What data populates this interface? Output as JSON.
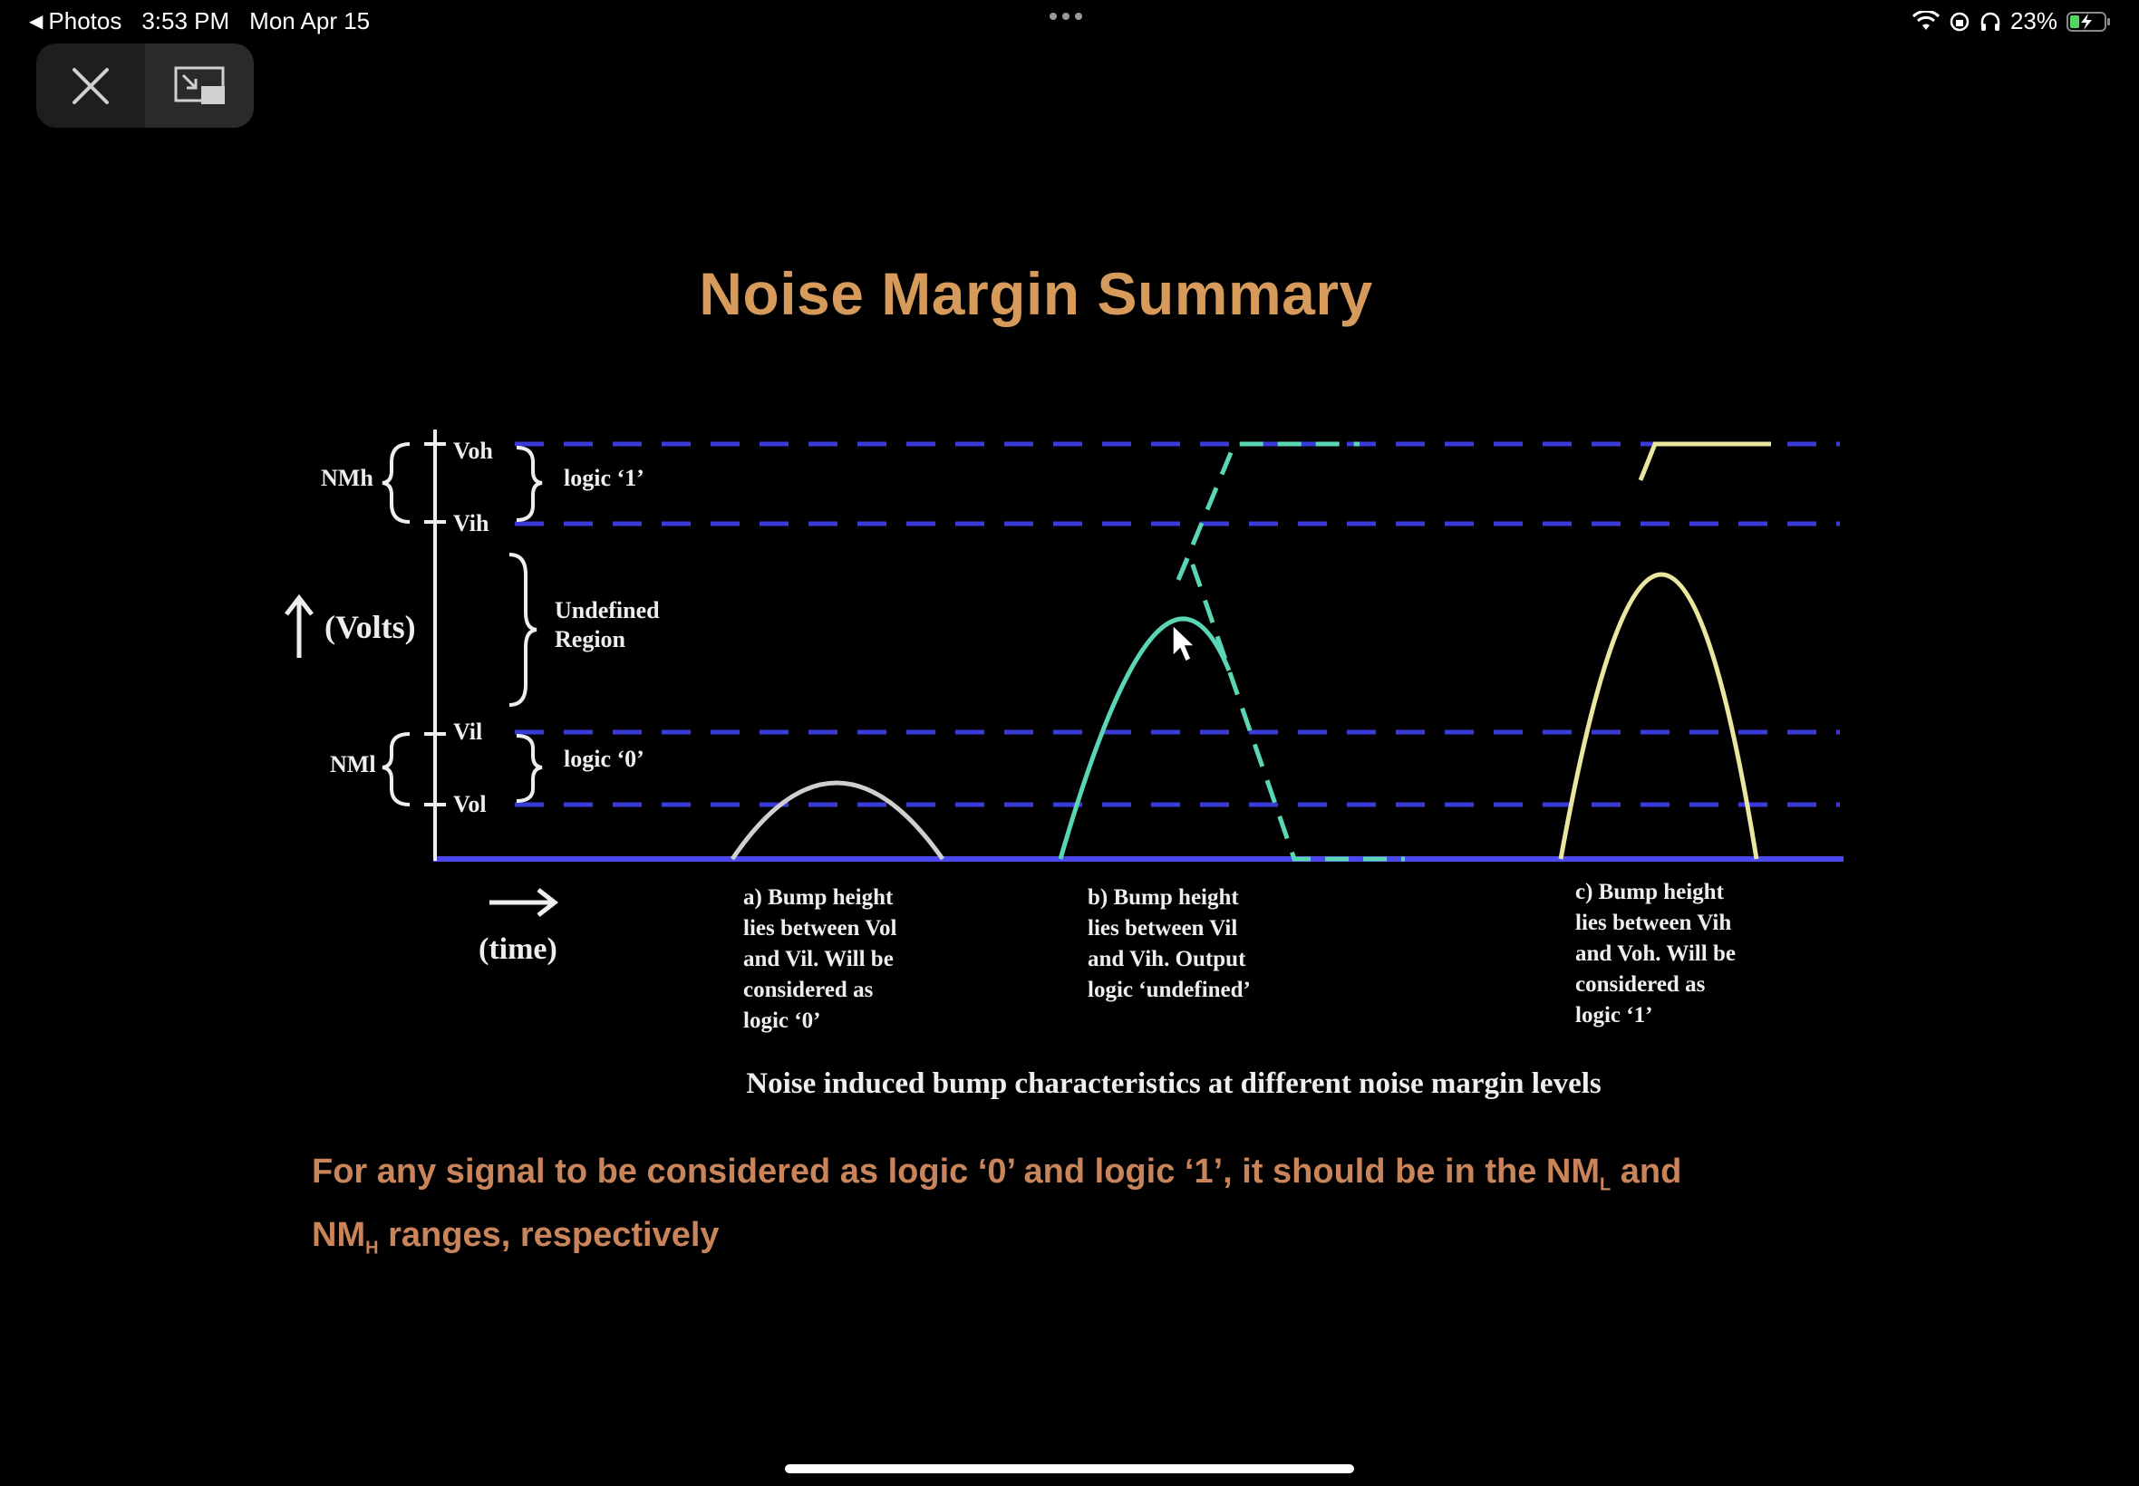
{
  "status_bar": {
    "back_app": "Photos",
    "time": "3:53 PM",
    "date": "Mon Apr 15",
    "battery": "23%"
  },
  "controls": {
    "close_icon": "close-icon",
    "exit_fullscreen_icon": "picture-in-picture-icon"
  },
  "slide": {
    "title": "Noise Margin Summary",
    "levels": [
      "Voh",
      "Vih",
      "Vil",
      "Vol"
    ],
    "nm_high": "NMh",
    "nm_low": "NMl",
    "logic_one": "logic ‘1’",
    "logic_zero": "logic ‘0’",
    "undefined_line1": "Undefined",
    "undefined_line2": "Region",
    "y_axis": "(Volts)",
    "x_axis": "(time)",
    "note_a": [
      "a) Bump height",
      "lies between Vol",
      "and Vil. Will be",
      "considered as",
      "logic ‘0’"
    ],
    "note_b": [
      "b) Bump height",
      "lies between Vil",
      "and Vih. Output",
      "logic ‘undefined’"
    ],
    "note_c": [
      "c) Bump height",
      "lies between Vih",
      "and Voh. Will be",
      "considered as",
      "logic ‘1’"
    ],
    "caption": "Noise induced bump characteristics at different noise margin levels",
    "footnote_part1": "For any signal to be considered as logic ‘0’ and logic ‘1’, it should be in the NM",
    "footnote_sub1": "L",
    "footnote_part2": " and NM",
    "footnote_sub2": "H",
    "footnote_part3": " ranges, respectively"
  },
  "colors": {
    "title": "#d69a5a",
    "dashed_levels": "#3a3ad8",
    "bump_a": "#cfcfcf",
    "bump_b": "#5ad6b4",
    "bump_c": "#e9e6a0",
    "footnote": "#c9845a"
  }
}
